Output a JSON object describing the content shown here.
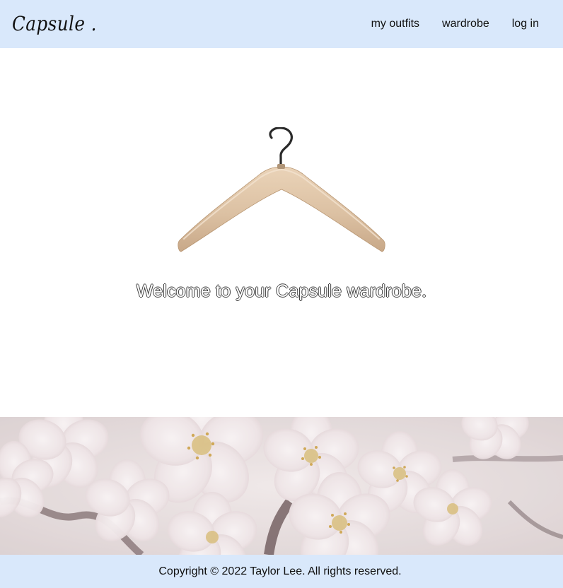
{
  "header": {
    "brand": "Capsule .",
    "nav": {
      "outfits_label": "my outfits",
      "wardrobe_label": "wardrobe",
      "login_label": "log in"
    }
  },
  "hero": {
    "welcome_text": "Welcome to your Capsule wardrobe."
  },
  "footer": {
    "copyright": "Copyright © 2022 Taylor Lee. All rights reserved."
  },
  "colors": {
    "header_bg": "#d9e8fb",
    "footer_bg": "#d9e8fb",
    "hanger_wood": "#dcc1a3"
  }
}
